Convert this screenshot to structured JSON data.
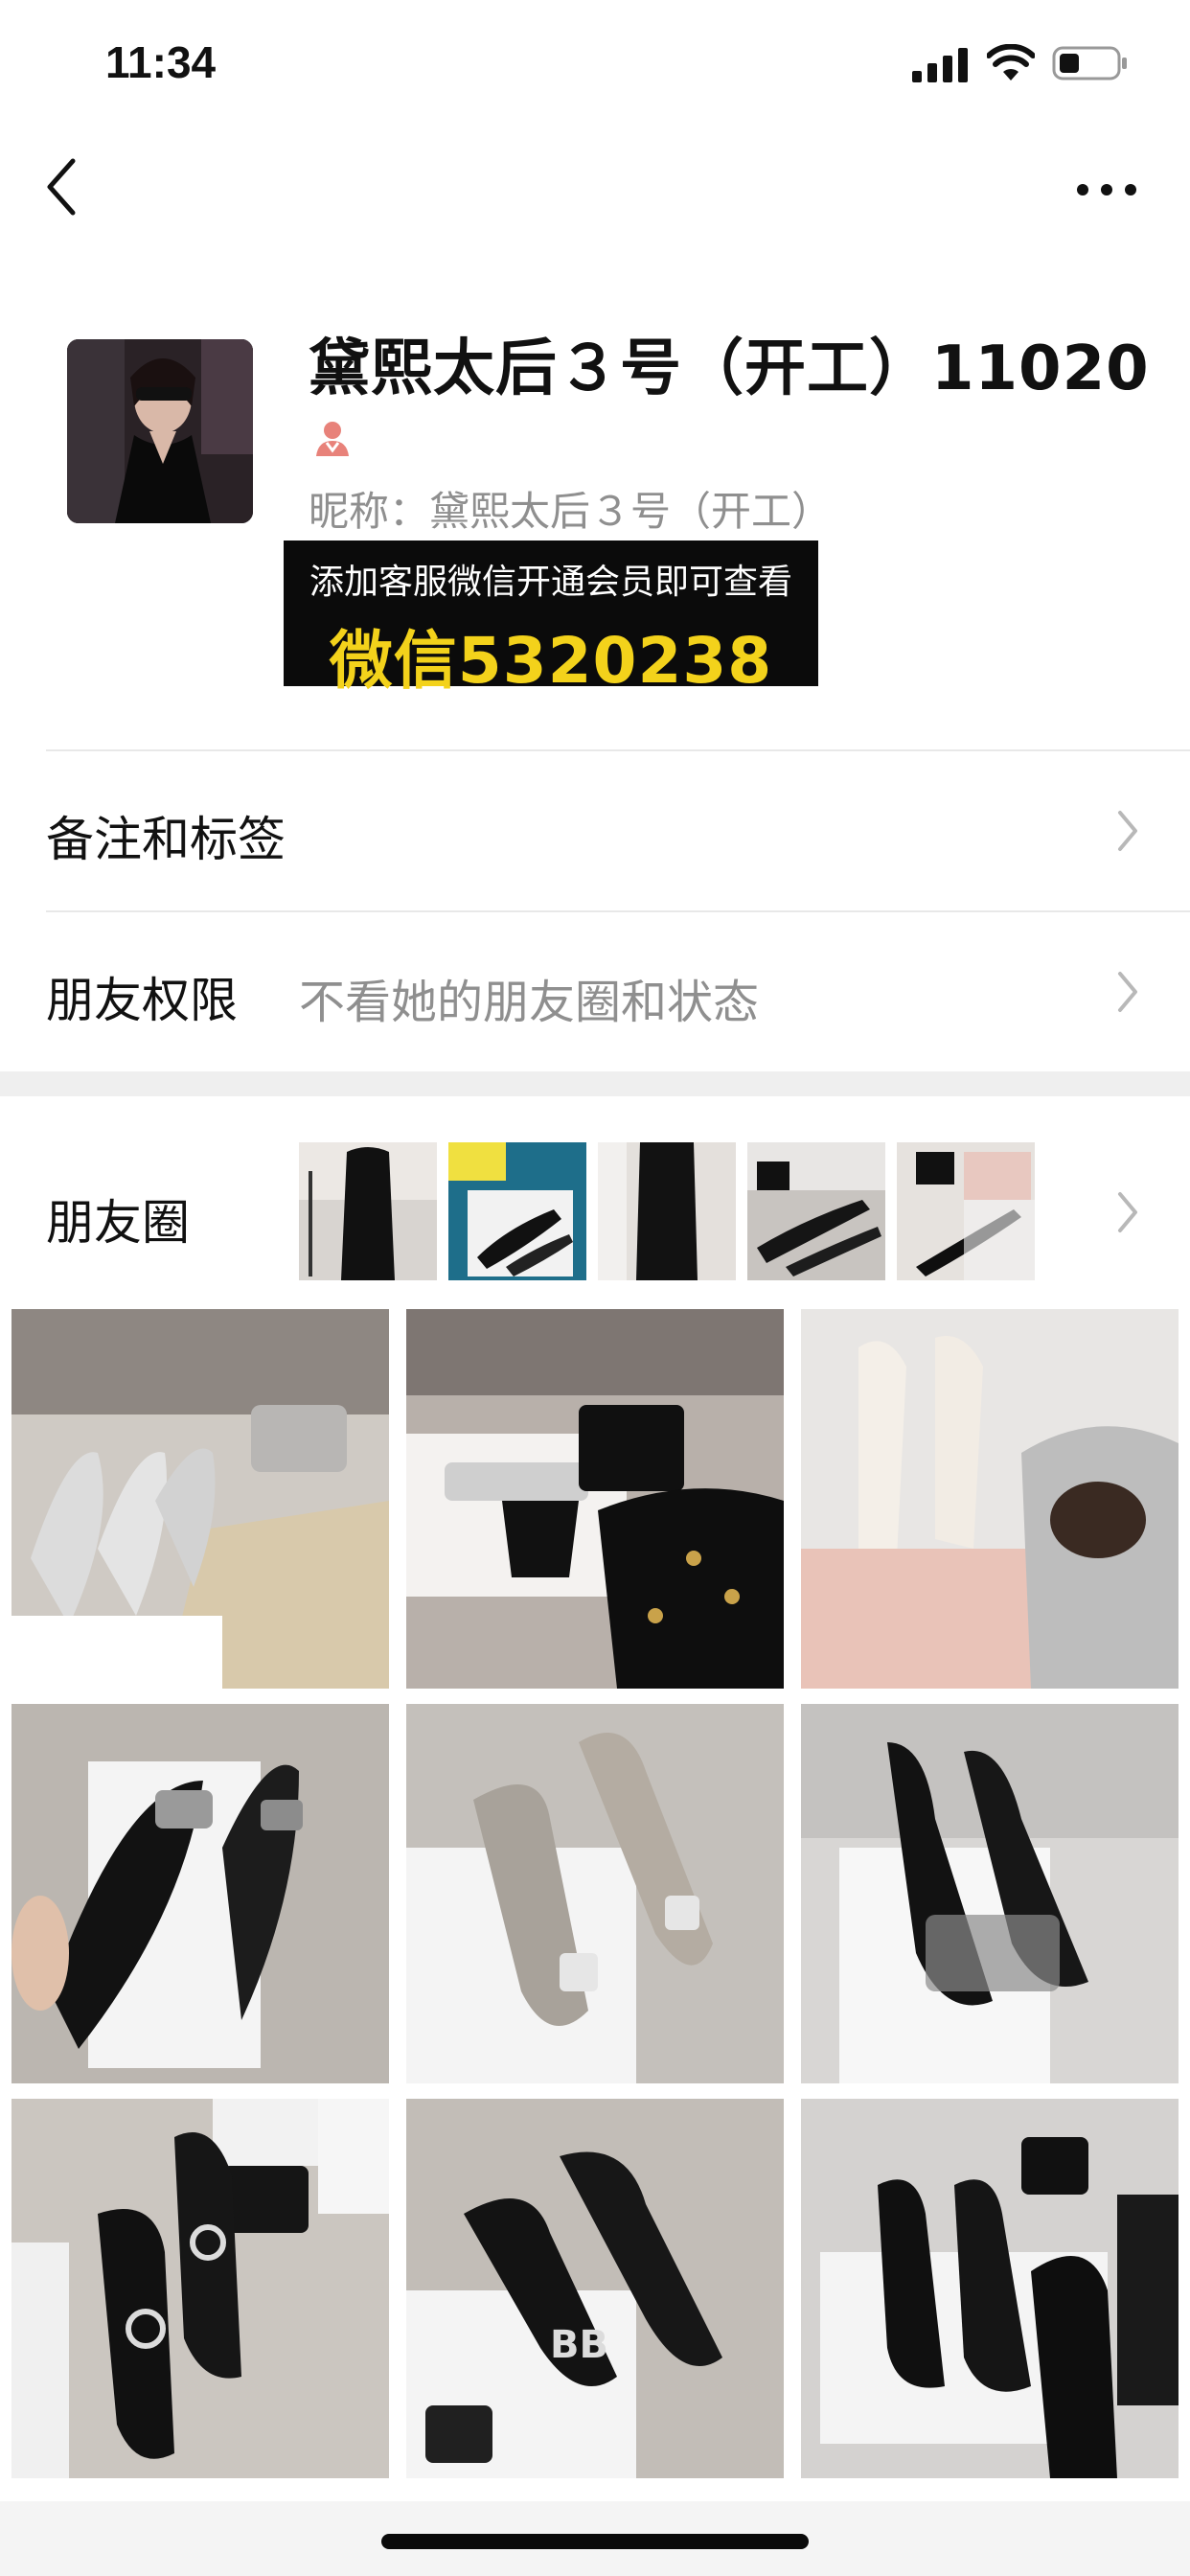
{
  "status_bar": {
    "time": "11:34"
  },
  "nav": {
    "back_icon": "chevron-left-icon",
    "more_icon": "ellipsis-icon"
  },
  "profile": {
    "name": "黛熙太后３号（开工）11020",
    "gender_icon": "female-person-icon",
    "nickname_label": "昵称：",
    "nickname": "黛熙太后３号（开工）"
  },
  "promo": {
    "line1": "添加客服微信开通会员即可查看",
    "line2": "微信5320238",
    "accent_color": "#f3d21b"
  },
  "rows": {
    "remarks": {
      "label": "备注和标签"
    },
    "permissions": {
      "label": "朋友权限",
      "value": "不看她的朋友圈和状态"
    },
    "moments": {
      "label": "朋友圈"
    }
  },
  "moments_thumbnails": [
    "black-dress-photo",
    "black-heels-photo",
    "black-dress-photo",
    "black-heels-photo",
    "black-heels-photo"
  ],
  "photo_grid": [
    "silver-heels-photo",
    "crystal-sandals-photo",
    "lace-heels-photo",
    "black-pumps-photo",
    "glitter-pumps-photo",
    "crystal-slingbacks-photo",
    "buckle-pumps-photo",
    "bb-pumps-photo",
    "black-boots-photo"
  ]
}
